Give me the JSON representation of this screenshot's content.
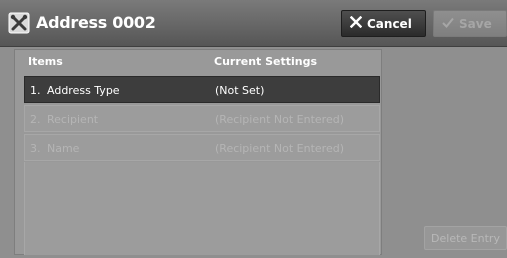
{
  "window": {
    "title": "Address 0002"
  },
  "toolbar": {
    "cancel_label": "Cancel",
    "save_label": "Save"
  },
  "table": {
    "headers": {
      "items": "Items",
      "current_settings": "Current Settings"
    },
    "rows": [
      {
        "number": "1.",
        "label": "Address Type",
        "value": "(Not Set)",
        "state": "selected"
      },
      {
        "number": "2.",
        "label": "Recipient",
        "value": "(Recipient Not Entered)",
        "state": "disabled"
      },
      {
        "number": "3.",
        "label": "Name",
        "value": "(Recipient Not Entered)",
        "state": "disabled"
      }
    ]
  },
  "actions": {
    "delete_entry_label": "Delete Entry"
  },
  "icons": {
    "title": "address-book-tools-icon",
    "cancel": "close-icon",
    "save": "checkmark-icon"
  },
  "colors": {
    "selected_row": "#3d3d3d",
    "titlebar": "#565656",
    "background": "#8f8f8f"
  }
}
